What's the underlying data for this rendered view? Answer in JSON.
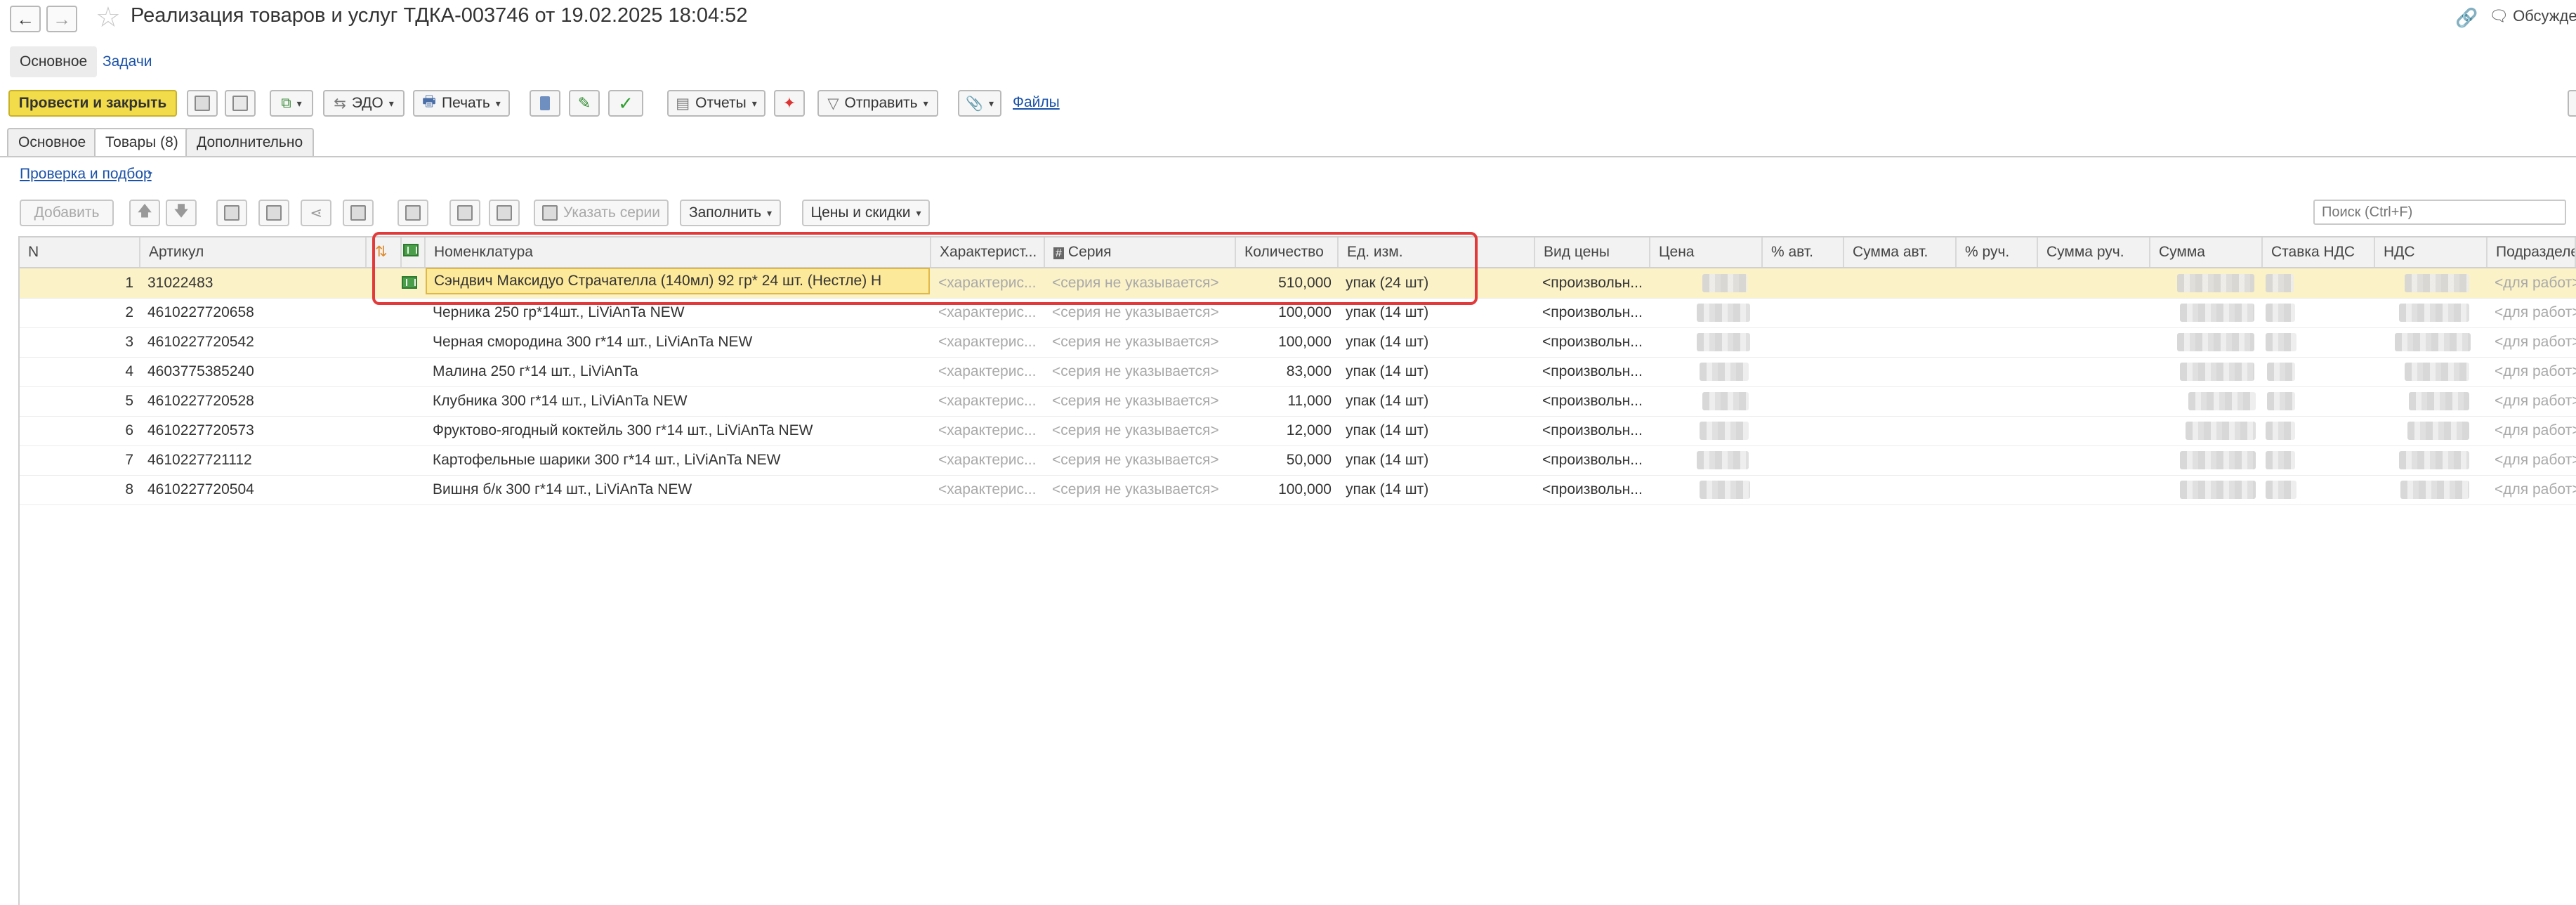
{
  "window": {
    "title": "Реализация товаров и услуг ТДКА-003746 от 19.02.2025 18:04:52",
    "discuss_label": "Обсужде"
  },
  "sections": {
    "main": "Основное",
    "tasks": "Задачи"
  },
  "toolbar": {
    "post_close": "Провести и закрыть",
    "edo": "ЭДО",
    "print": "Печать",
    "reports": "Отчеты",
    "send": "Отправить",
    "files": "Файлы"
  },
  "tabs": {
    "main": "Основное",
    "goods": "Товары (8)",
    "extra": "Дополнительно"
  },
  "check_link": "Проверка и подбор",
  "table_toolbar": {
    "add": "Добавить",
    "series": "Указать серии",
    "fill": "Заполнить",
    "prices": "Цены и скидки",
    "search_placeholder": "Поиск (Ctrl+F)"
  },
  "columns": {
    "n": "N",
    "article": "Артикул",
    "nomenclature": "Номенклатура",
    "characteristic": "Характерист...",
    "series": "Серия",
    "quantity": "Количество",
    "unit": "Ед. изм.",
    "price_type": "Вид цены",
    "price": "Цена",
    "pct_auto": "% авт.",
    "sum_auto": "Сумма авт.",
    "pct_manual": "% руч.",
    "sum_manual": "Сумма руч.",
    "sum": "Сумма",
    "vat_rate": "Ставка НДС",
    "vat": "НДС",
    "division": "Подразделен"
  },
  "rows": [
    {
      "n": "1",
      "article": "31022483",
      "name": "Сэндвич Максидуо Страчателла (140мл) 92 гр* 24 шт. (Нестле) Н",
      "char": "<характерис...",
      "series": "<серия не указывается>",
      "qty": "510,000",
      "unit": "упак (24 шт)",
      "price_type": "<произвольн...",
      "division": "<для работ>"
    },
    {
      "n": "2",
      "article": "4610227720658",
      "name": "Черника 250 гр*14шт., LiViAnTa NEW",
      "char": "<характерис...",
      "series": "<серия не указывается>",
      "qty": "100,000",
      "unit": "упак (14 шт)",
      "price_type": "<произвольн...",
      "division": "<для работ>"
    },
    {
      "n": "3",
      "article": "4610227720542",
      "name": "Черная смородина 300 г*14 шт., LiViAnTa NEW",
      "char": "<характерис...",
      "series": "<серия не указывается>",
      "qty": "100,000",
      "unit": "упак (14 шт)",
      "price_type": "<произвольн...",
      "division": "<для работ>"
    },
    {
      "n": "4",
      "article": "4603775385240",
      "name": "Малина 250 г*14 шт., LiViAnTa",
      "char": "<характерис...",
      "series": "<серия не указывается>",
      "qty": "83,000",
      "unit": "упак (14 шт)",
      "price_type": "<произвольн...",
      "division": "<для работ>"
    },
    {
      "n": "5",
      "article": "4610227720528",
      "name": "Клубника 300 г*14 шт., LiViAnTa NEW",
      "char": "<характерис...",
      "series": "<серия не указывается>",
      "qty": "11,000",
      "unit": "упак (14 шт)",
      "price_type": "<произвольн...",
      "division": "<для работ>"
    },
    {
      "n": "6",
      "article": "4610227720573",
      "name": "Фруктово-ягодный коктейль 300 г*14 шт., LiViAnTa NEW",
      "char": "<характерис...",
      "series": "<серия не указывается>",
      "qty": "12,000",
      "unit": "упак (14 шт)",
      "price_type": "<произвольн...",
      "division": "<для работ>"
    },
    {
      "n": "7",
      "article": "4610227721112",
      "name": "Картофельные шарики 300 г*14 шт., LiViAnTa NEW",
      "char": "<характерис...",
      "series": "<серия не указывается>",
      "qty": "50,000",
      "unit": "упак (14 шт)",
      "price_type": "<произвольн...",
      "division": "<для работ>"
    },
    {
      "n": "8",
      "article": "4610227720504",
      "name": "Вишня б/к 300 г*14 шт., LiViAnTa NEW",
      "char": "<характерис...",
      "series": "<серия не указывается>",
      "qty": "100,000",
      "unit": "упак (14 шт)",
      "price_type": "<произвольн...",
      "division": "<для работ>"
    }
  ],
  "colors": {
    "accent": "#f2dc4a",
    "link": "#1a52a8",
    "highlight": "#e23a3a",
    "selected_row": "#fbf2c7"
  }
}
